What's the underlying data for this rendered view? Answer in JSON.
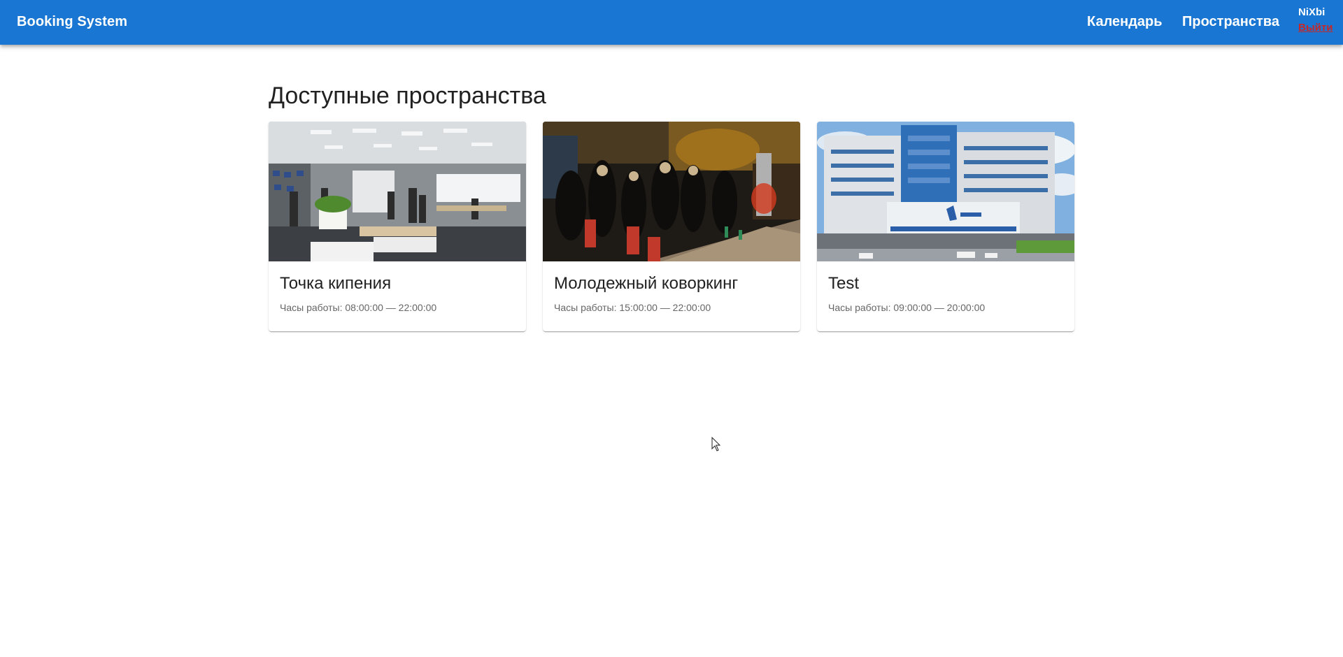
{
  "header": {
    "brand": "Booking System",
    "nav": [
      {
        "label": "Календарь"
      },
      {
        "label": "Пространства"
      }
    ],
    "user": {
      "name": "NiXbi",
      "logout": "Выйти"
    },
    "background_color": "#1976d2",
    "logout_color": "#c62828"
  },
  "main": {
    "title": "Доступные пространства",
    "spaces": [
      {
        "name": "Точка кипения",
        "hours": "Часы работы: 08:00:00 — 22:00:00",
        "image": "office-coworking-photo"
      },
      {
        "name": "Молодежный коворкинг",
        "hours": "Часы работы: 15:00:00 — 22:00:00",
        "image": "evening-event-photo"
      },
      {
        "name": "Test",
        "hours": "Часы работы: 09:00:00 — 20:00:00",
        "image": "university-building-photo"
      }
    ]
  }
}
